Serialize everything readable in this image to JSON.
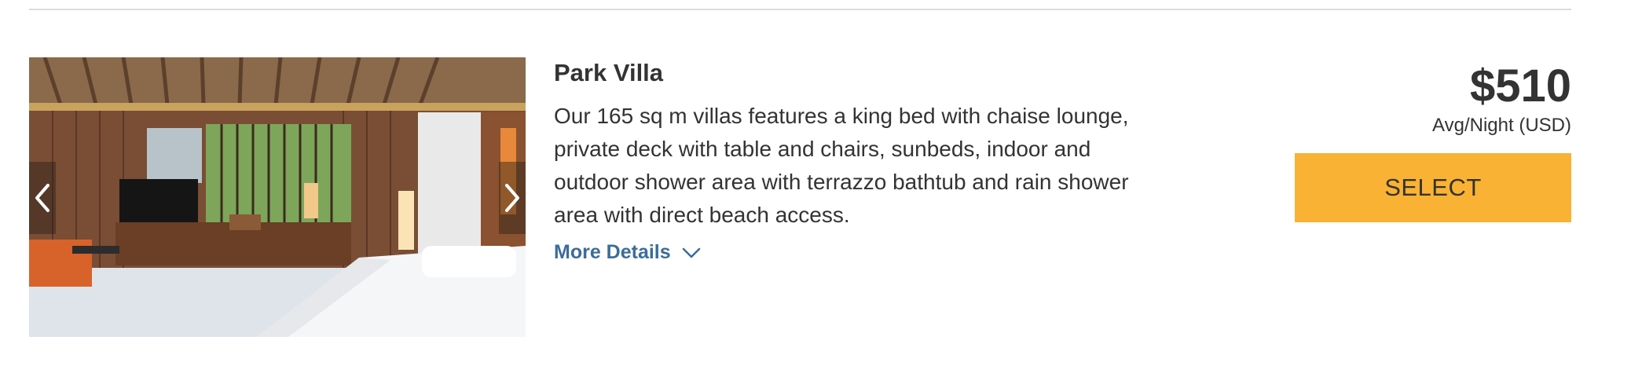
{
  "room": {
    "name": "Park Villa",
    "description": "Our 165 sq m villas features a king bed with chaise lounge, private deck with table and chairs, sunbeds, indoor and outdoor shower area with terrazzo bathtub and rain shower area with direct beach access.",
    "more_details_label": "More Details"
  },
  "pricing": {
    "price": "$510",
    "unit_label": "Avg/Night (USD)",
    "select_label": "SELECT"
  },
  "carousel": {
    "prev_icon": "chevron-left-icon",
    "next_icon": "chevron-right-icon"
  },
  "colors": {
    "select_button": "#f9b233",
    "link": "#3a6d9a",
    "text": "#333333",
    "divider": "#dcdcdc"
  }
}
